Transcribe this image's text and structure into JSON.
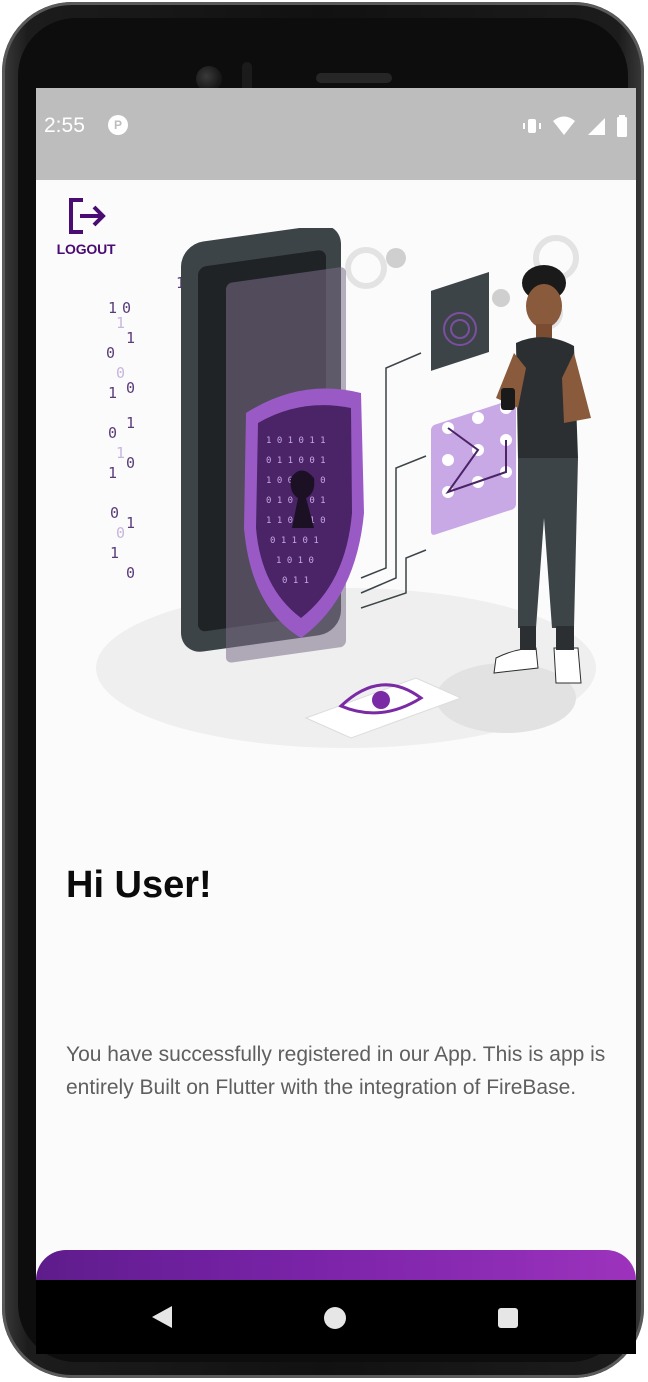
{
  "status_bar": {
    "time": "2:55",
    "app_icon_letter": "P",
    "icons": [
      "vibrate-icon",
      "wifi-icon",
      "signal-icon",
      "battery-icon"
    ]
  },
  "logout": {
    "label": "LOGOUT",
    "icon": "logout-icon"
  },
  "hero": {
    "icon": "security-illustration"
  },
  "greeting": {
    "title": "Hi User!"
  },
  "message": {
    "text": "You have successfully registered in our App. This is app is entirely Built on Flutter with the integration of FireBase."
  },
  "nav_bar": {
    "icons": [
      "back-icon",
      "home-icon",
      "recent-apps-icon"
    ]
  },
  "colors": {
    "accent": "#6a1f99",
    "accent_light": "#9d33bd",
    "dark_purple": "#4a0b73",
    "status_bar": "#bdbdbd",
    "title": "#0b0b0b",
    "body": "#5f5f5f"
  }
}
